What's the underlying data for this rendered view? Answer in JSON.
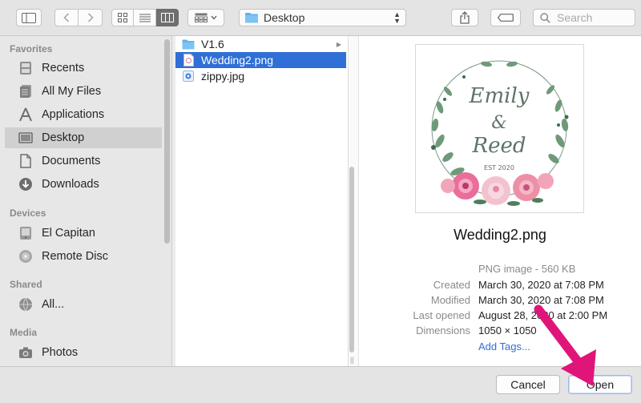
{
  "toolbar": {
    "location": "Desktop",
    "search_placeholder": "Search"
  },
  "sidebar": {
    "sections": [
      {
        "title": "Favorites",
        "items": [
          {
            "label": "Recents",
            "icon": "recents-icon"
          },
          {
            "label": "All My Files",
            "icon": "all-files-icon"
          },
          {
            "label": "Applications",
            "icon": "applications-icon"
          },
          {
            "label": "Desktop",
            "icon": "desktop-icon",
            "selected": true
          },
          {
            "label": "Documents",
            "icon": "documents-icon"
          },
          {
            "label": "Downloads",
            "icon": "downloads-icon"
          }
        ]
      },
      {
        "title": "Devices",
        "items": [
          {
            "label": "El Capitan",
            "icon": "disk-icon"
          },
          {
            "label": "Remote Disc",
            "icon": "remote-disc-icon"
          }
        ]
      },
      {
        "title": "Shared",
        "items": [
          {
            "label": "All...",
            "icon": "network-icon"
          }
        ]
      },
      {
        "title": "Media",
        "items": [
          {
            "label": "Photos",
            "icon": "camera-icon"
          }
        ]
      }
    ]
  },
  "files": [
    {
      "name": "V1.6",
      "icon": "folder-icon",
      "has_children": true
    },
    {
      "name": "Wedding2.png",
      "icon": "png-file-icon",
      "selected": true
    },
    {
      "name": "zippy.jpg",
      "icon": "jpg-file-icon"
    }
  ],
  "preview": {
    "thumb": {
      "line1": "Emily",
      "line2": "&",
      "line3": "Reed",
      "line4": "EST 2020"
    },
    "name": "Wedding2.png",
    "kind": "PNG image - 560 KB",
    "meta": [
      {
        "label": "Created",
        "value": "March 30, 2020 at 7:08 PM"
      },
      {
        "label": "Modified",
        "value": "March 30, 2020 at 7:08 PM"
      },
      {
        "label": "Last opened",
        "value": "August 28, 2020 at 2:00 PM"
      },
      {
        "label": "Dimensions",
        "value": "1050 × 1050"
      }
    ],
    "add_tags": "Add Tags..."
  },
  "buttons": {
    "cancel": "Cancel",
    "open": "Open"
  },
  "colors": {
    "selection": "#2f6fd6",
    "arrow": "#e0157a"
  }
}
